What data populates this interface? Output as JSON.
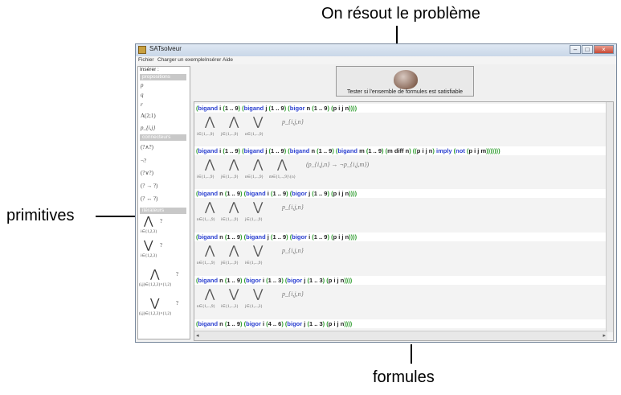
{
  "annotations": {
    "top": "On résout le problème",
    "left": "primitives",
    "bottom": "formules"
  },
  "window": {
    "title": "SATsolveur",
    "menu": [
      "Fichier",
      "Charger un exemple",
      "Insérer",
      "Aide"
    ],
    "controls": {
      "minimize": "–",
      "maximize": "□",
      "close": "×"
    }
  },
  "left_panel": {
    "top_label": "Insérer :",
    "sections": {
      "propositions": "propositions",
      "connecteurs": "connecteurs",
      "iterateurs": "itérateurs"
    },
    "propositions": [
      "p",
      "q",
      "r",
      "A(2;1)",
      "p_{i,j}"
    ],
    "connecteurs": [
      "(?∧?)",
      "¬?",
      "(?∨?)",
      "(? → ?)",
      "(? ↔ ?)"
    ],
    "iterateurs": [
      {
        "op": "⋀",
        "sub": "i∈{1,2,3}",
        "body": "?"
      },
      {
        "op": "⋁",
        "sub": "i∈{1,2,3}",
        "body": "?"
      },
      {
        "op": "⋀",
        "sub": "(i,j)∈{1,2,3}×{1,2}",
        "body": "?"
      },
      {
        "op": "⋁",
        "sub": "(i,j)∈{1,2,3}×{1,2}",
        "body": "?"
      }
    ]
  },
  "solve_button": {
    "label": "Tester si l'ensemble de formules est satisfiable",
    "icon": "brain-icon"
  },
  "formulas": [
    {
      "code": [
        [
          "p",
          "("
        ],
        [
          "k",
          "bigand"
        ],
        [
          "v",
          " i "
        ],
        [
          "p",
          "("
        ],
        [
          "v",
          "1 .. 9"
        ],
        [
          "p",
          ")"
        ],
        [
          "v",
          " "
        ],
        [
          "p",
          "("
        ],
        [
          "k",
          "bigand"
        ],
        [
          "v",
          " j "
        ],
        [
          "p",
          "("
        ],
        [
          "v",
          "1 .. 9"
        ],
        [
          "p",
          ")"
        ],
        [
          "v",
          " "
        ],
        [
          "p",
          "("
        ],
        [
          "k",
          "bigor"
        ],
        [
          "v",
          " n "
        ],
        [
          "p",
          "("
        ],
        [
          "v",
          "1 .. 9"
        ],
        [
          "p",
          ")"
        ],
        [
          "v",
          " "
        ],
        [
          "p",
          "("
        ],
        [
          "v",
          "p i j n"
        ],
        [
          "p",
          "))))"
        ]
      ],
      "math": {
        "ops": [
          "⋀",
          "⋀",
          "⋁"
        ],
        "subs": [
          "i∈{1,...,9}",
          "j∈{1,...,9}",
          "n∈{1,...,9}"
        ],
        "body": "p_{i,j,n}"
      }
    },
    {
      "code": [
        [
          "p",
          "("
        ],
        [
          "k",
          "bigand"
        ],
        [
          "v",
          " i "
        ],
        [
          "p",
          "("
        ],
        [
          "v",
          "1 .. 9"
        ],
        [
          "p",
          ")"
        ],
        [
          "v",
          " "
        ],
        [
          "p",
          "("
        ],
        [
          "k",
          "bigand"
        ],
        [
          "v",
          " j "
        ],
        [
          "p",
          "("
        ],
        [
          "v",
          "1 .. 9"
        ],
        [
          "p",
          ")"
        ],
        [
          "v",
          " "
        ],
        [
          "p",
          "("
        ],
        [
          "k",
          "bigand"
        ],
        [
          "v",
          " n "
        ],
        [
          "p",
          "("
        ],
        [
          "v",
          "1 .. 9"
        ],
        [
          "p",
          ")"
        ],
        [
          "v",
          " "
        ],
        [
          "p",
          "("
        ],
        [
          "k",
          "bigand"
        ],
        [
          "v",
          " m "
        ],
        [
          "p",
          "("
        ],
        [
          "v",
          "1 .. 9"
        ],
        [
          "p",
          ")"
        ],
        [
          "v",
          " "
        ],
        [
          "p",
          "("
        ],
        [
          "v",
          "m diff n"
        ],
        [
          "p",
          ")"
        ],
        [
          "v",
          " "
        ],
        [
          "p",
          "(("
        ],
        [
          "v",
          "p i j n"
        ],
        [
          "p",
          ")"
        ],
        [
          "v",
          " "
        ],
        [
          "k",
          "imply"
        ],
        [
          "v",
          " "
        ],
        [
          "p",
          "("
        ],
        [
          "k",
          "not"
        ],
        [
          "v",
          " "
        ],
        [
          "p",
          "("
        ],
        [
          "v",
          "p i j m"
        ],
        [
          "p",
          ")))))))"
        ]
      ],
      "math": {
        "ops": [
          "⋀",
          "⋀",
          "⋀",
          "⋀"
        ],
        "subs": [
          "i∈{1,...,9}",
          "j∈{1,...,9}",
          "n∈{1,...,9}",
          "m∈{1,...,9}\\{n}"
        ],
        "body": "(p_{i,j,n} → ¬p_{i,j,m})"
      }
    },
    {
      "code": [
        [
          "p",
          "("
        ],
        [
          "k",
          "bigand"
        ],
        [
          "v",
          " n "
        ],
        [
          "p",
          "("
        ],
        [
          "v",
          "1 .. 9"
        ],
        [
          "p",
          ")"
        ],
        [
          "v",
          " "
        ],
        [
          "p",
          "("
        ],
        [
          "k",
          "bigand"
        ],
        [
          "v",
          " i "
        ],
        [
          "p",
          "("
        ],
        [
          "v",
          "1 .. 9"
        ],
        [
          "p",
          ")"
        ],
        [
          "v",
          " "
        ],
        [
          "p",
          "("
        ],
        [
          "k",
          "bigor"
        ],
        [
          "v",
          " j "
        ],
        [
          "p",
          "("
        ],
        [
          "v",
          "1 .. 9"
        ],
        [
          "p",
          ")"
        ],
        [
          "v",
          " "
        ],
        [
          "p",
          "("
        ],
        [
          "v",
          "p i j n"
        ],
        [
          "p",
          "))))"
        ]
      ],
      "math": {
        "ops": [
          "⋀",
          "⋀",
          "⋁"
        ],
        "subs": [
          "n∈{1,...,9}",
          "i∈{1,...,9}",
          "j∈{1,...,9}"
        ],
        "body": "p_{i,j,n}"
      }
    },
    {
      "code": [
        [
          "p",
          "("
        ],
        [
          "k",
          "bigand"
        ],
        [
          "v",
          " n "
        ],
        [
          "p",
          "("
        ],
        [
          "v",
          "1 .. 9"
        ],
        [
          "p",
          ")"
        ],
        [
          "v",
          " "
        ],
        [
          "p",
          "("
        ],
        [
          "k",
          "bigand"
        ],
        [
          "v",
          " j "
        ],
        [
          "p",
          "("
        ],
        [
          "v",
          "1 .. 9"
        ],
        [
          "p",
          ")"
        ],
        [
          "v",
          " "
        ],
        [
          "p",
          "("
        ],
        [
          "k",
          "bigor"
        ],
        [
          "v",
          " i "
        ],
        [
          "p",
          "("
        ],
        [
          "v",
          "1 .. 9"
        ],
        [
          "p",
          ")"
        ],
        [
          "v",
          " "
        ],
        [
          "p",
          "("
        ],
        [
          "v",
          "p i j n"
        ],
        [
          "p",
          "))))"
        ]
      ],
      "math": {
        "ops": [
          "⋀",
          "⋀",
          "⋁"
        ],
        "subs": [
          "n∈{1,...,9}",
          "j∈{1,...,9}",
          "i∈{1,...,9}"
        ],
        "body": "p_{i,j,n}"
      }
    },
    {
      "code": [
        [
          "p",
          "("
        ],
        [
          "k",
          "bigand"
        ],
        [
          "v",
          " n "
        ],
        [
          "p",
          "("
        ],
        [
          "v",
          "1 .. 9"
        ],
        [
          "p",
          ")"
        ],
        [
          "v",
          " "
        ],
        [
          "p",
          "("
        ],
        [
          "k",
          "bigor"
        ],
        [
          "v",
          " i "
        ],
        [
          "p",
          "("
        ],
        [
          "v",
          "1 .. 3"
        ],
        [
          "p",
          ")"
        ],
        [
          "v",
          " "
        ],
        [
          "p",
          "("
        ],
        [
          "k",
          "bigor"
        ],
        [
          "v",
          " j "
        ],
        [
          "p",
          "("
        ],
        [
          "v",
          "1 .. 3"
        ],
        [
          "p",
          ")"
        ],
        [
          "v",
          " "
        ],
        [
          "p",
          "("
        ],
        [
          "v",
          "p i j n"
        ],
        [
          "p",
          "))))"
        ]
      ],
      "math": {
        "ops": [
          "⋀",
          "⋁",
          "⋁"
        ],
        "subs": [
          "n∈{1,...,9}",
          "i∈{1,...,3}",
          "j∈{1,...,3}"
        ],
        "body": "p_{i,j,n}"
      }
    },
    {
      "code": [
        [
          "p",
          "("
        ],
        [
          "k",
          "bigand"
        ],
        [
          "v",
          " n "
        ],
        [
          "p",
          "("
        ],
        [
          "v",
          "1 .. 9"
        ],
        [
          "p",
          ")"
        ],
        [
          "v",
          " "
        ],
        [
          "p",
          "("
        ],
        [
          "k",
          "bigor"
        ],
        [
          "v",
          " i "
        ],
        [
          "p",
          "("
        ],
        [
          "v",
          "4 .. 6"
        ],
        [
          "p",
          ")"
        ],
        [
          "v",
          " "
        ],
        [
          "p",
          "("
        ],
        [
          "k",
          "bigor"
        ],
        [
          "v",
          " j "
        ],
        [
          "p",
          "("
        ],
        [
          "v",
          "1 .. 3"
        ],
        [
          "p",
          ")"
        ],
        [
          "v",
          " "
        ],
        [
          "p",
          "("
        ],
        [
          "v",
          "p i j n"
        ],
        [
          "p",
          "))))"
        ]
      ],
      "math": null
    }
  ]
}
